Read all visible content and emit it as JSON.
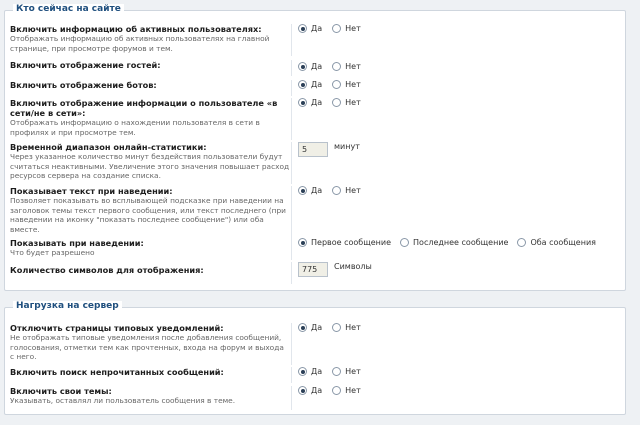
{
  "section1": {
    "legend": "Кто сейчас на сайте",
    "rows": [
      {
        "title": "Включить информацию об активных пользователях:",
        "desc": "Отображать информацию об активных пользователях на главной странице, при просмотре форумов и тем.",
        "options": [
          "Да",
          "Нет"
        ]
      },
      {
        "title": "Включить отображение гостей:",
        "options": [
          "Да",
          "Нет"
        ]
      },
      {
        "title": "Включить отображение ботов:",
        "options": [
          "Да",
          "Нет"
        ]
      },
      {
        "title": "Включить отображение информации о пользователе «в сети/не в сети»:",
        "desc": "Отображать информацию о нахождении пользователя в сети в профилях и при просмотре тем.",
        "options": [
          "Да",
          "Нет"
        ]
      },
      {
        "title": "Временной диапазон онлайн-статистики:",
        "desc": "Через указанное количество минут бездействия пользователи будут считаться неактивными. Увеличение этого значения повышает расход ресурсов сервера на создание списка.",
        "value": "5",
        "suffix": "минут"
      },
      {
        "title": "Показывает текст при наведении:",
        "desc": "Позволяет показывать во всплывающей подсказке при наведении на заголовок темы текст первого сообщения, или текст последнего (при наведении на иконку \"показать последнее сообщение\") или оба вместе.",
        "options": [
          "Да",
          "Нет"
        ]
      },
      {
        "title": "Показывать при наведении:",
        "desc": "Что будет разрешено",
        "options": [
          "Первое сообщение",
          "Последнее сообщение",
          "Оба сообщения"
        ]
      },
      {
        "title": "Количество символов для отображения:",
        "value": "775",
        "suffix": "Символы"
      }
    ]
  },
  "section2": {
    "legend": "Нагрузка на сервер",
    "rows": [
      {
        "title": "Отключить страницы типовых уведомлений:",
        "desc": "Не отображать типовые уведомления после добавления сообщений, голосования, отметки тем как прочтенных, входа на форум и выхода с него.",
        "options": [
          "Да",
          "Нет"
        ]
      },
      {
        "title": "Включить поиск непрочитанных сообщений:",
        "options": [
          "Да",
          "Нет"
        ]
      },
      {
        "title": "Включить свои темы:",
        "desc": "Указывать, оставлял ли пользователь сообщения в теме.",
        "options": [
          "Да",
          "Нет"
        ]
      }
    ]
  }
}
